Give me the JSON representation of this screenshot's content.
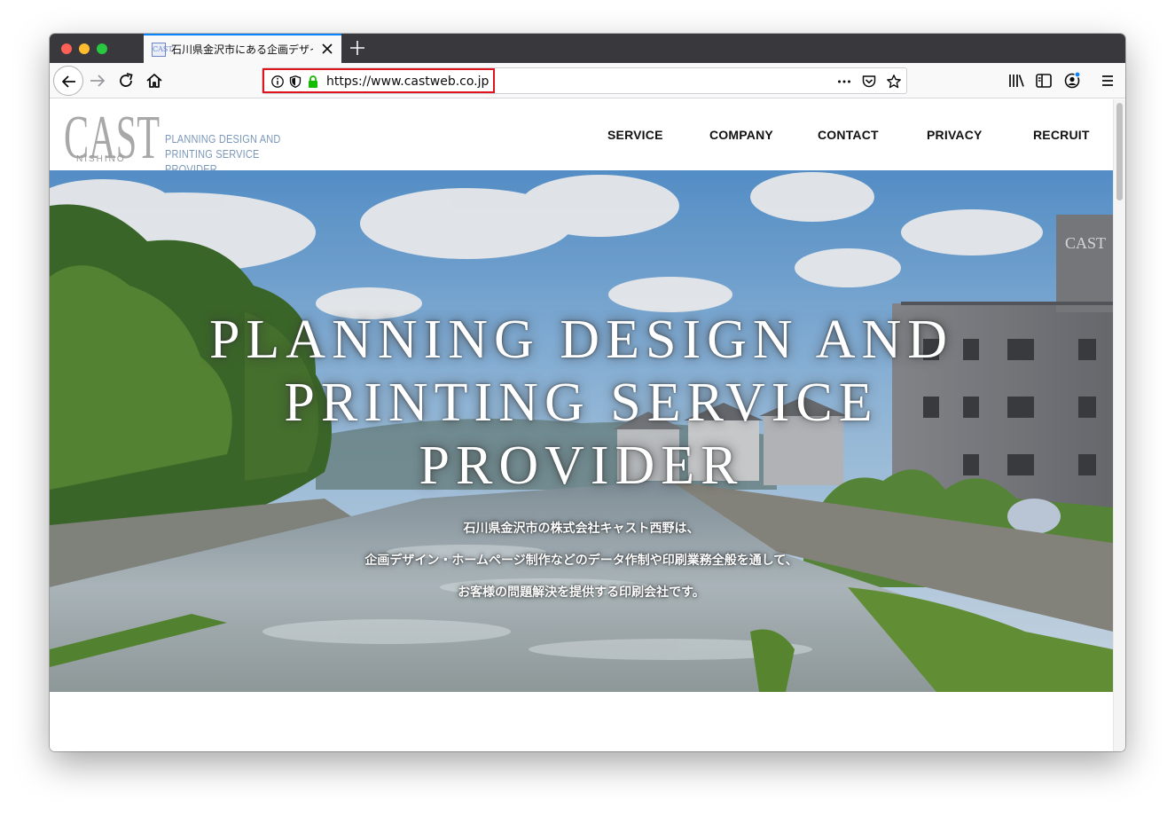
{
  "browser": {
    "tab": {
      "title": "石川県金沢市にある企画デザイン",
      "favicon_text": "CAST"
    },
    "url": "https://www.castweb.co.jp",
    "colors": {
      "accent": "#0a84ff",
      "highlight": "#e0141e",
      "secure_lock": "#12bc00"
    },
    "icons": {
      "back": "back-arrow-icon",
      "forward": "forward-arrow-icon",
      "reload": "reload-icon",
      "home": "home-icon",
      "info": "info-icon",
      "tracking": "shield-icon",
      "lock": "lock-icon",
      "more": "more-icon",
      "pocket": "pocket-icon",
      "bookmark": "star-icon",
      "library": "library-icon",
      "sidebar": "sidebar-icon",
      "account": "account-icon",
      "menu": "hamburger-menu-icon"
    }
  },
  "site": {
    "logo": {
      "wordmark": "CAST",
      "subtext": "NISHINO",
      "tagline_line1": "PLANNING DESIGN AND",
      "tagline_line2": "PRINTING SERVICE PROVIDER"
    },
    "nav": [
      {
        "label": "SERVICE"
      },
      {
        "label": "COMPANY"
      },
      {
        "label": "CONTACT"
      },
      {
        "label": "PRIVACY"
      },
      {
        "label": "RECRUIT"
      }
    ],
    "hero": {
      "headline_line1": "PLANNING DESIGN AND",
      "headline_line2": "PRINTING SERVICE",
      "headline_line3": "PROVIDER",
      "sub_line1": "石川県金沢市の株式会社キャスト西野は、",
      "sub_line2": "企画デザイン・ホームページ制作などのデータ作制や印刷業務全般を通して、",
      "sub_line3": "お客様の問題解決を提供する印刷会社です。",
      "building_sign": "CAST"
    }
  }
}
